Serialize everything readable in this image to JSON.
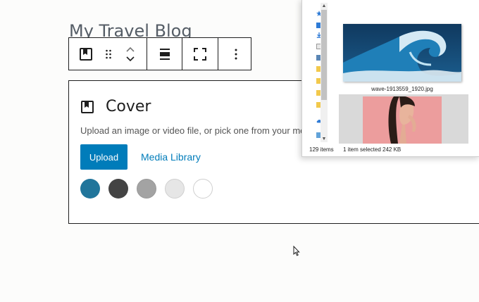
{
  "editor": {
    "post_title": "My Travel Blog",
    "cover": {
      "title": "Cover",
      "instructions": "Upload an image or video file, or pick one from your media library.",
      "upload_label": "Upload",
      "media_library_label": "Media Library",
      "swatch_colors": [
        "#21759b",
        "#444444",
        "#a3a3a3",
        "#e6e6e6",
        "#ffffff"
      ]
    },
    "toolbar": {
      "icons": [
        "cover-icon",
        "drag-handle-icon",
        "move-up-icon",
        "move-down-icon",
        "align-icon",
        "fullscreen-icon",
        "more-options-icon"
      ]
    }
  },
  "explorer": {
    "selected_file_name": "wave-1913559_1920.jpg",
    "items_count": "129 items",
    "selection_status": "1 item selected  242 KB"
  },
  "colors": {
    "accent": "#007cba",
    "border": "#1e1e1e"
  }
}
